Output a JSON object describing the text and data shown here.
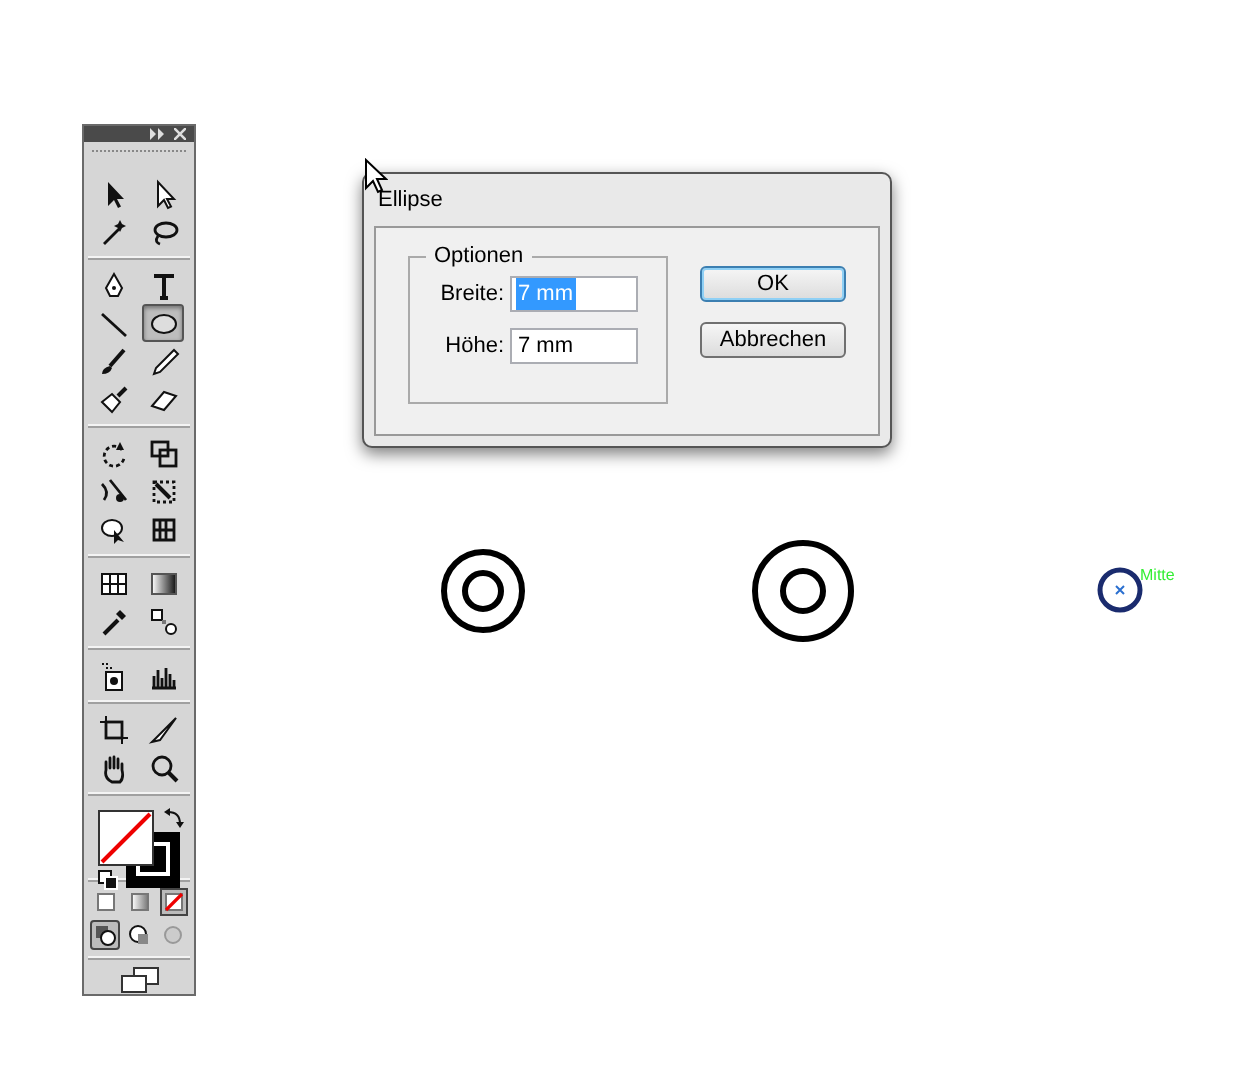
{
  "toolbox": {
    "tools": [
      {
        "selected": false
      },
      {
        "selected": false
      },
      {
        "selected": false
      },
      {
        "selected": false
      },
      {
        "selected": false
      },
      {
        "selected": false
      },
      {
        "selected": false
      },
      {
        "selected": true
      },
      {
        "selected": false
      },
      {
        "selected": false
      },
      {
        "selected": false
      },
      {
        "selected": false
      },
      {
        "selected": false
      },
      {
        "selected": false
      },
      {
        "selected": false
      },
      {
        "selected": false
      },
      {
        "selected": false
      },
      {
        "selected": false
      },
      {
        "selected": false
      },
      {
        "selected": false
      },
      {
        "selected": false
      },
      {
        "selected": false
      },
      {
        "selected": false
      },
      {
        "selected": false
      },
      {
        "selected": false
      },
      {
        "selected": false
      },
      {
        "selected": false
      },
      {
        "selected": false
      }
    ],
    "color_modes": [
      {
        "selected": false
      },
      {
        "selected": false
      },
      {
        "selected": true
      }
    ],
    "draw_modes": [
      {
        "selected": true
      },
      {
        "selected": false
      },
      {
        "selected": false
      }
    ]
  },
  "dialog": {
    "title": "Ellipse",
    "group": "Optionen",
    "fields": [
      {
        "label": "Breite:",
        "value": "7 mm",
        "text_selected": true
      },
      {
        "label": "Höhe:",
        "value": "7 mm",
        "text_selected": false
      }
    ],
    "buttons": [
      {
        "label": "OK",
        "default": true
      },
      {
        "label": "Abbrechen",
        "default": false
      }
    ]
  },
  "canvas": {
    "smart_guide_label": "Mitte"
  }
}
